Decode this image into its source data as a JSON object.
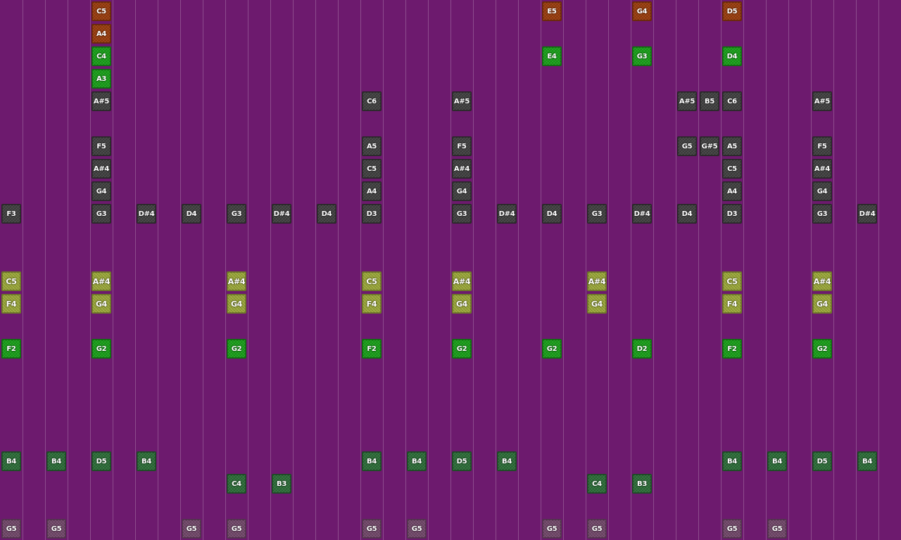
{
  "palette": {
    "background": "#6d1a6e",
    "line": "#8a4f8c",
    "gray": "#404040",
    "orange": "#9a3c0c",
    "green": "#19a019",
    "olive": "#9ca93a",
    "darkgreen": "#2c6d38",
    "pink": "#72486a"
  },
  "notes": [
    {
      "col": 4,
      "row": 0,
      "label": "C5",
      "kind": "orange"
    },
    {
      "col": 24,
      "row": 0,
      "label": "E5",
      "kind": "orange"
    },
    {
      "col": 28,
      "row": 0,
      "label": "G4",
      "kind": "orange"
    },
    {
      "col": 32,
      "row": 0,
      "label": "D5",
      "kind": "orange"
    },
    {
      "col": 4,
      "row": 1,
      "label": "A4",
      "kind": "orange"
    },
    {
      "col": 4,
      "row": 2,
      "label": "C4",
      "kind": "green"
    },
    {
      "col": 24,
      "row": 2,
      "label": "E4",
      "kind": "green"
    },
    {
      "col": 28,
      "row": 2,
      "label": "G3",
      "kind": "green"
    },
    {
      "col": 32,
      "row": 2,
      "label": "D4",
      "kind": "green"
    },
    {
      "col": 4,
      "row": 3,
      "label": "A3",
      "kind": "green"
    },
    {
      "col": 4,
      "row": 4,
      "label": "A#5",
      "kind": "gray"
    },
    {
      "col": 16,
      "row": 4,
      "label": "C6",
      "kind": "gray"
    },
    {
      "col": 20,
      "row": 4,
      "label": "A#5",
      "kind": "gray"
    },
    {
      "col": 30,
      "row": 4,
      "label": "A#5",
      "kind": "gray"
    },
    {
      "col": 31,
      "row": 4,
      "label": "B5",
      "kind": "gray"
    },
    {
      "col": 32,
      "row": 4,
      "label": "C6",
      "kind": "gray"
    },
    {
      "col": 36,
      "row": 4,
      "label": "A#5",
      "kind": "gray"
    },
    {
      "col": 4,
      "row": 6,
      "label": "F5",
      "kind": "gray"
    },
    {
      "col": 16,
      "row": 6,
      "label": "A5",
      "kind": "gray"
    },
    {
      "col": 20,
      "row": 6,
      "label": "F5",
      "kind": "gray"
    },
    {
      "col": 30,
      "row": 6,
      "label": "G5",
      "kind": "gray"
    },
    {
      "col": 31,
      "row": 6,
      "label": "G#5",
      "kind": "gray"
    },
    {
      "col": 32,
      "row": 6,
      "label": "A5",
      "kind": "gray"
    },
    {
      "col": 36,
      "row": 6,
      "label": "F5",
      "kind": "gray"
    },
    {
      "col": 4,
      "row": 7,
      "label": "A#4",
      "kind": "gray"
    },
    {
      "col": 16,
      "row": 7,
      "label": "C5",
      "kind": "gray"
    },
    {
      "col": 20,
      "row": 7,
      "label": "A#4",
      "kind": "gray"
    },
    {
      "col": 32,
      "row": 7,
      "label": "C5",
      "kind": "gray"
    },
    {
      "col": 36,
      "row": 7,
      "label": "A#4",
      "kind": "gray"
    },
    {
      "col": 4,
      "row": 8,
      "label": "G4",
      "kind": "gray"
    },
    {
      "col": 16,
      "row": 8,
      "label": "A4",
      "kind": "gray"
    },
    {
      "col": 20,
      "row": 8,
      "label": "G4",
      "kind": "gray"
    },
    {
      "col": 32,
      "row": 8,
      "label": "A4",
      "kind": "gray"
    },
    {
      "col": 36,
      "row": 8,
      "label": "G4",
      "kind": "gray"
    },
    {
      "col": 0,
      "row": 9,
      "label": "F3",
      "kind": "gray"
    },
    {
      "col": 4,
      "row": 9,
      "label": "G3",
      "kind": "gray"
    },
    {
      "col": 6,
      "row": 9,
      "label": "D#4",
      "kind": "gray"
    },
    {
      "col": 8,
      "row": 9,
      "label": "D4",
      "kind": "gray"
    },
    {
      "col": 10,
      "row": 9,
      "label": "G3",
      "kind": "gray"
    },
    {
      "col": 12,
      "row": 9,
      "label": "D#4",
      "kind": "gray"
    },
    {
      "col": 14,
      "row": 9,
      "label": "D4",
      "kind": "gray"
    },
    {
      "col": 16,
      "row": 9,
      "label": "D3",
      "kind": "gray"
    },
    {
      "col": 20,
      "row": 9,
      "label": "G3",
      "kind": "gray"
    },
    {
      "col": 22,
      "row": 9,
      "label": "D#4",
      "kind": "gray"
    },
    {
      "col": 24,
      "row": 9,
      "label": "D4",
      "kind": "gray"
    },
    {
      "col": 26,
      "row": 9,
      "label": "G3",
      "kind": "gray"
    },
    {
      "col": 28,
      "row": 9,
      "label": "D#4",
      "kind": "gray"
    },
    {
      "col": 30,
      "row": 9,
      "label": "D4",
      "kind": "gray"
    },
    {
      "col": 32,
      "row": 9,
      "label": "D3",
      "kind": "gray"
    },
    {
      "col": 36,
      "row": 9,
      "label": "G3",
      "kind": "gray"
    },
    {
      "col": 38,
      "row": 9,
      "label": "D#4",
      "kind": "gray"
    },
    {
      "col": 0,
      "row": 12,
      "label": "C5",
      "kind": "olive"
    },
    {
      "col": 4,
      "row": 12,
      "label": "A#4",
      "kind": "olive"
    },
    {
      "col": 10,
      "row": 12,
      "label": "A#4",
      "kind": "olive"
    },
    {
      "col": 16,
      "row": 12,
      "label": "C5",
      "kind": "olive"
    },
    {
      "col": 20,
      "row": 12,
      "label": "A#4",
      "kind": "olive"
    },
    {
      "col": 26,
      "row": 12,
      "label": "A#4",
      "kind": "olive"
    },
    {
      "col": 32,
      "row": 12,
      "label": "C5",
      "kind": "olive"
    },
    {
      "col": 36,
      "row": 12,
      "label": "A#4",
      "kind": "olive"
    },
    {
      "col": 0,
      "row": 13,
      "label": "F4",
      "kind": "olive"
    },
    {
      "col": 4,
      "row": 13,
      "label": "G4",
      "kind": "olive"
    },
    {
      "col": 10,
      "row": 13,
      "label": "G4",
      "kind": "olive"
    },
    {
      "col": 16,
      "row": 13,
      "label": "F4",
      "kind": "olive"
    },
    {
      "col": 20,
      "row": 13,
      "label": "G4",
      "kind": "olive"
    },
    {
      "col": 26,
      "row": 13,
      "label": "G4",
      "kind": "olive"
    },
    {
      "col": 32,
      "row": 13,
      "label": "F4",
      "kind": "olive"
    },
    {
      "col": 36,
      "row": 13,
      "label": "G4",
      "kind": "olive"
    },
    {
      "col": 0,
      "row": 15,
      "label": "F2",
      "kind": "green"
    },
    {
      "col": 4,
      "row": 15,
      "label": "G2",
      "kind": "green"
    },
    {
      "col": 10,
      "row": 15,
      "label": "G2",
      "kind": "green"
    },
    {
      "col": 16,
      "row": 15,
      "label": "F2",
      "kind": "green"
    },
    {
      "col": 20,
      "row": 15,
      "label": "G2",
      "kind": "green"
    },
    {
      "col": 24,
      "row": 15,
      "label": "G2",
      "kind": "green"
    },
    {
      "col": 28,
      "row": 15,
      "label": "D2",
      "kind": "green"
    },
    {
      "col": 32,
      "row": 15,
      "label": "F2",
      "kind": "green"
    },
    {
      "col": 36,
      "row": 15,
      "label": "G2",
      "kind": "green"
    },
    {
      "col": 0,
      "row": 20,
      "label": "B4",
      "kind": "darkgreen"
    },
    {
      "col": 2,
      "row": 20,
      "label": "B4",
      "kind": "darkgreen"
    },
    {
      "col": 4,
      "row": 20,
      "label": "D5",
      "kind": "darkgreen"
    },
    {
      "col": 6,
      "row": 20,
      "label": "B4",
      "kind": "darkgreen"
    },
    {
      "col": 16,
      "row": 20,
      "label": "B4",
      "kind": "darkgreen"
    },
    {
      "col": 18,
      "row": 20,
      "label": "B4",
      "kind": "darkgreen"
    },
    {
      "col": 20,
      "row": 20,
      "label": "D5",
      "kind": "darkgreen"
    },
    {
      "col": 22,
      "row": 20,
      "label": "B4",
      "kind": "darkgreen"
    },
    {
      "col": 32,
      "row": 20,
      "label": "B4",
      "kind": "darkgreen"
    },
    {
      "col": 34,
      "row": 20,
      "label": "B4",
      "kind": "darkgreen"
    },
    {
      "col": 36,
      "row": 20,
      "label": "D5",
      "kind": "darkgreen"
    },
    {
      "col": 38,
      "row": 20,
      "label": "B4",
      "kind": "darkgreen"
    },
    {
      "col": 10,
      "row": 21,
      "label": "C4",
      "kind": "darkgreen"
    },
    {
      "col": 12,
      "row": 21,
      "label": "B3",
      "kind": "darkgreen"
    },
    {
      "col": 26,
      "row": 21,
      "label": "C4",
      "kind": "darkgreen"
    },
    {
      "col": 28,
      "row": 21,
      "label": "B3",
      "kind": "darkgreen"
    },
    {
      "col": 0,
      "row": 23,
      "label": "G5",
      "kind": "pink"
    },
    {
      "col": 2,
      "row": 23,
      "label": "G5",
      "kind": "pink"
    },
    {
      "col": 8,
      "row": 23,
      "label": "G5",
      "kind": "pink"
    },
    {
      "col": 10,
      "row": 23,
      "label": "G5",
      "kind": "pink"
    },
    {
      "col": 16,
      "row": 23,
      "label": "G5",
      "kind": "pink"
    },
    {
      "col": 18,
      "row": 23,
      "label": "G5",
      "kind": "pink"
    },
    {
      "col": 24,
      "row": 23,
      "label": "G5",
      "kind": "pink"
    },
    {
      "col": 26,
      "row": 23,
      "label": "G5",
      "kind": "pink"
    },
    {
      "col": 32,
      "row": 23,
      "label": "G5",
      "kind": "pink"
    },
    {
      "col": 34,
      "row": 23,
      "label": "G5",
      "kind": "pink"
    }
  ]
}
